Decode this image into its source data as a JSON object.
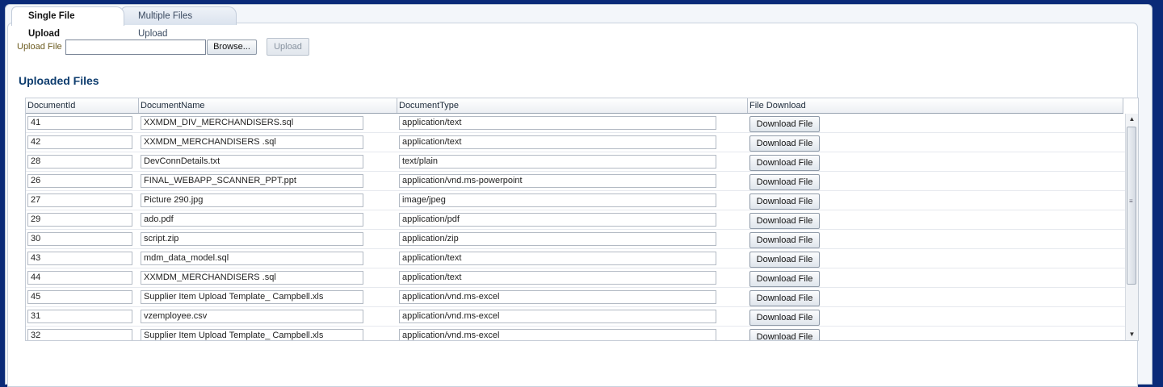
{
  "tabs": [
    {
      "label": "Single File Upload",
      "active": true
    },
    {
      "label": "Multiple Files Upload",
      "active": false
    }
  ],
  "upload": {
    "label": "Upload File",
    "file_value": "",
    "browse_label": "Browse...",
    "upload_label": "Upload"
  },
  "section_title": "Uploaded Files",
  "table": {
    "columns": [
      "DocumentId",
      "DocumentName",
      "DocumentType",
      "File Download"
    ],
    "download_label": "Download File",
    "rows": [
      {
        "id": "41",
        "name": "XXMDM_DIV_MERCHANDISERS.sql",
        "type": "application/text"
      },
      {
        "id": "42",
        "name": "XXMDM_MERCHANDISERS .sql",
        "type": "application/text"
      },
      {
        "id": "28",
        "name": "DevConnDetails.txt",
        "type": "text/plain"
      },
      {
        "id": "26",
        "name": "FINAL_WEBAPP_SCANNER_PPT.ppt",
        "type": "application/vnd.ms-powerpoint"
      },
      {
        "id": "27",
        "name": "Picture 290.jpg",
        "type": "image/jpeg"
      },
      {
        "id": "29",
        "name": "ado.pdf",
        "type": "application/pdf"
      },
      {
        "id": "30",
        "name": "script.zip",
        "type": "application/zip"
      },
      {
        "id": "43",
        "name": "mdm_data_model.sql",
        "type": "application/text"
      },
      {
        "id": "44",
        "name": "XXMDM_MERCHANDISERS .sql",
        "type": "application/text"
      },
      {
        "id": "45",
        "name": "Supplier Item Upload Template_ Campbell.xls",
        "type": "application/vnd.ms-excel"
      },
      {
        "id": "31",
        "name": "vzemployee.csv",
        "type": "application/vnd.ms-excel"
      },
      {
        "id": "32",
        "name": "Supplier Item Upload Template_ Campbell.xls",
        "type": "application/vnd.ms-excel"
      }
    ]
  },
  "icons": {
    "scroll_up": "triangle-up-icon",
    "scroll_down": "triangle-down-icon",
    "scroll_grip": "grip-icon"
  }
}
